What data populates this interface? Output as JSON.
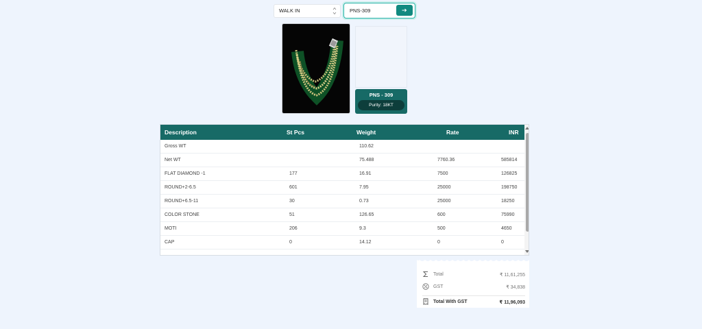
{
  "customer_select": {
    "value": "WALK IN"
  },
  "search": {
    "value": "PNS-309"
  },
  "product": {
    "code": "PNS - 309",
    "purity": "Purity: 18KT"
  },
  "table": {
    "headers": [
      "Description",
      "St Pcs",
      "Weight",
      "Rate",
      "INR"
    ],
    "rows": [
      [
        "Gross WT",
        "",
        "110.62",
        "",
        ""
      ],
      [
        "Net WT",
        "",
        "75.488",
        "7760.36",
        "585814"
      ],
      [
        "FLAT DIAMOND -1",
        "177",
        "16.91",
        "7500",
        "126825"
      ],
      [
        "ROUND+2-6.5",
        "601",
        "7.95",
        "25000",
        "198750"
      ],
      [
        "ROUND+6.5-11",
        "30",
        "0.73",
        "25000",
        "18250"
      ],
      [
        "COLOR STONE",
        "51",
        "126.65",
        "600",
        "75990"
      ],
      [
        "MOTI",
        "206",
        "9.3",
        "500",
        "4650"
      ],
      [
        "CAP",
        "0",
        "14.12",
        "0",
        "0"
      ]
    ]
  },
  "totals": {
    "total_label": "Total",
    "total_value": "₹ 11,61,255",
    "gst_label": "GST",
    "gst_value": "₹ 34,838",
    "grand_label": "Total With GST",
    "grand_value": "₹ 11,96,093"
  },
  "colors": {
    "accent": "#176a66",
    "button": "#118a80",
    "background": "#eef4fd"
  }
}
